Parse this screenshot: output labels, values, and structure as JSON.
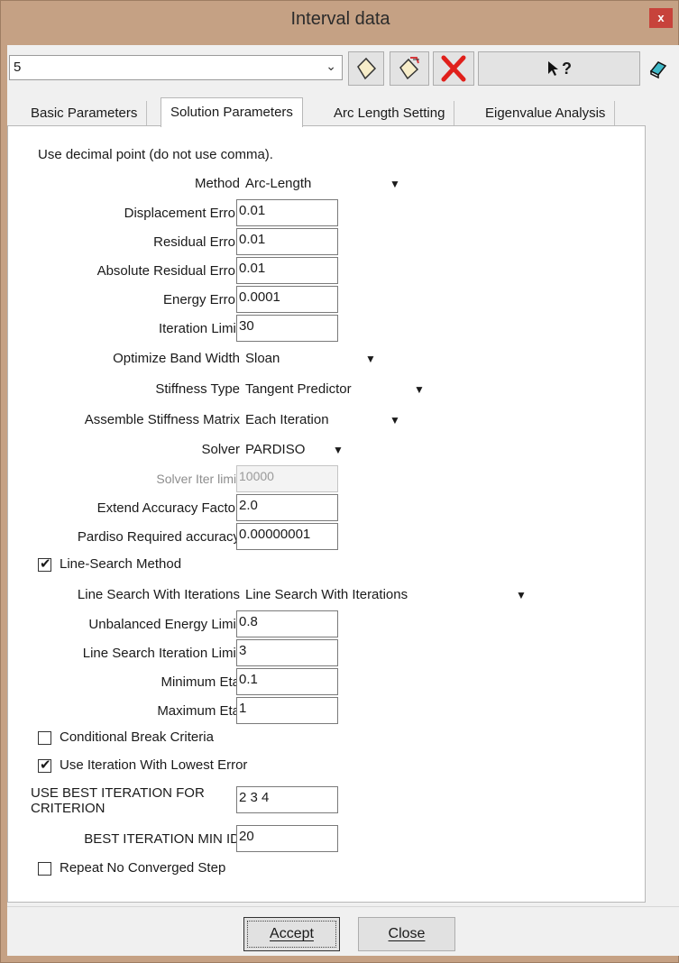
{
  "window": {
    "title": "Interval data",
    "close_label": "x"
  },
  "toolbar": {
    "interval_value": "5",
    "help_label": "?"
  },
  "tabs": [
    {
      "label": "Basic Parameters"
    },
    {
      "label": "Solution Parameters"
    },
    {
      "label": "Arc Length Setting"
    },
    {
      "label": "Eigenvalue Analysis"
    }
  ],
  "form": {
    "note": "Use decimal point (do not use comma).",
    "method": {
      "label": "Method",
      "value": "Arc-Length"
    },
    "displacement_error": {
      "label": "Displacement Error",
      "value": "0.01"
    },
    "residual_error": {
      "label": "Residual Error",
      "value": "0.01"
    },
    "absolute_residual_error": {
      "label": "Absolute Residual Error",
      "value": "0.01"
    },
    "energy_error": {
      "label": "Energy Error",
      "value": "0.0001"
    },
    "iteration_limit": {
      "label": "Iteration Limit",
      "value": "30"
    },
    "optimize_band_width": {
      "label": "Optimize Band Width",
      "value": "Sloan"
    },
    "stiffness_type": {
      "label": "Stiffness Type",
      "value": "Tangent Predictor"
    },
    "assemble_stiffness_matrix": {
      "label": "Assemble Stiffness Matrix",
      "value": "Each Iteration"
    },
    "solver": {
      "label": "Solver",
      "value": "PARDISO"
    },
    "solver_iter_limit": {
      "label": "Solver Iter limit",
      "value": "10000"
    },
    "extend_accuracy_factor": {
      "label": "Extend Accuracy Factor",
      "value": "2.0"
    },
    "pardiso_required_accuracy": {
      "label": "Pardiso Required accuracy",
      "value": "0.00000001"
    },
    "line_search_method": {
      "label": "Line-Search Method",
      "checked": true
    },
    "line_search_with_iterations": {
      "label": "Line Search With Iterations",
      "value": "Line Search With Iterations"
    },
    "unbalanced_energy_limit": {
      "label": "Unbalanced Energy Limit",
      "value": "0.8"
    },
    "line_search_iteration_limit": {
      "label": "Line Search Iteration Limit",
      "value": "3"
    },
    "minimum_eta": {
      "label": "Minimum Eta",
      "value": "0.1"
    },
    "maximum_eta": {
      "label": "Maximum Eta",
      "value": "1"
    },
    "conditional_break_criteria": {
      "label": "Conditional Break Criteria",
      "checked": false
    },
    "use_iteration_with_lowest_error": {
      "label": "Use Iteration With Lowest Error",
      "checked": true
    },
    "use_best_iteration_for_criterion": {
      "label": "USE BEST ITERATION FOR CRITERION",
      "value": "2 3 4"
    },
    "best_iteration_min_id": {
      "label": "BEST ITERATION MIN ID",
      "value": "20"
    },
    "repeat_no_converged_step": {
      "label": "Repeat No Converged Step",
      "checked": false
    }
  },
  "buttons": {
    "accept": "Accept",
    "close": "Close"
  },
  "colors": {
    "frame": "#c5a184",
    "close_button": "#c7433b",
    "delete_icon": "#e0201b"
  }
}
